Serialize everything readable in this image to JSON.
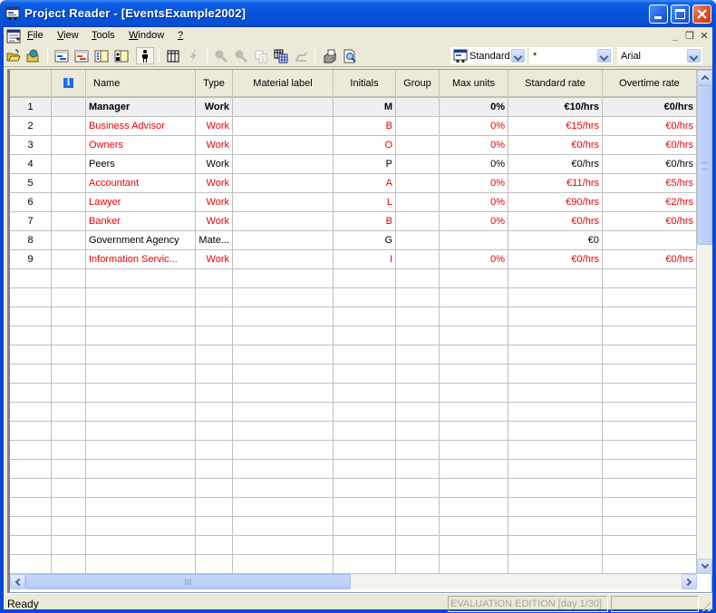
{
  "window": {
    "title": "Project Reader - [EventsExample2002]",
    "controls": {
      "minimize": "minimize",
      "maximize": "maximize",
      "close": "close"
    }
  },
  "menubar": {
    "items": [
      {
        "label": "File",
        "accel": "F"
      },
      {
        "label": "View",
        "accel": "V"
      },
      {
        "label": "Tools",
        "accel": "T"
      },
      {
        "label": "Window",
        "accel": "W"
      },
      {
        "label": "?",
        "accel": "?"
      }
    ],
    "mdi_controls": [
      "minimize",
      "restore",
      "close"
    ]
  },
  "toolbar": {
    "buttons": [
      {
        "icon": "open-folder-icon",
        "enabled": true
      },
      {
        "icon": "open-web-icon",
        "enabled": true
      },
      {
        "icon": "gantt-chart-icon",
        "enabled": true
      },
      {
        "icon": "tracking-gantt-icon",
        "enabled": true
      },
      {
        "icon": "task-usage-icon",
        "enabled": true
      },
      {
        "icon": "resource-usage-icon",
        "enabled": true
      },
      {
        "icon": "resource-sheet-icon",
        "enabled": true,
        "pressed": true
      },
      {
        "icon": "table-icon",
        "enabled": true
      },
      {
        "icon": "lightning-icon",
        "enabled": false
      },
      {
        "icon": "zoom-in-icon",
        "enabled": false
      },
      {
        "icon": "zoom-out-icon",
        "enabled": false
      },
      {
        "icon": "copy-icon",
        "enabled": false
      },
      {
        "icon": "copy-picture-icon",
        "enabled": true
      },
      {
        "icon": "go-to-icon",
        "enabled": false
      },
      {
        "icon": "print-icon",
        "enabled": true
      },
      {
        "icon": "print-preview-icon",
        "enabled": true
      }
    ],
    "table_combo": {
      "value": "Standard"
    },
    "filter_combo": {
      "value": "*"
    },
    "font_combo": {
      "value": "Arial"
    }
  },
  "grid": {
    "columns": [
      "",
      "i",
      "Name",
      "Type",
      "Material label",
      "Initials",
      "Group",
      "Max units",
      "Standard rate",
      "Overtime rate"
    ],
    "rows": [
      {
        "id": "1",
        "name": "Manager",
        "type": "Work",
        "material": "",
        "initials": "M",
        "group": "",
        "max_units": "0%",
        "std_rate": "€10/hrs",
        "ot_rate": "€0/hrs",
        "style": "bold",
        "selected": true
      },
      {
        "id": "2",
        "name": "Business Advisor",
        "type": "Work",
        "material": "",
        "initials": "B",
        "group": "",
        "max_units": "0%",
        "std_rate": "€15/hrs",
        "ot_rate": "€0/hrs",
        "style": "red"
      },
      {
        "id": "3",
        "name": "Owners",
        "type": "Work",
        "material": "",
        "initials": "O",
        "group": "",
        "max_units": "0%",
        "std_rate": "€0/hrs",
        "ot_rate": "€0/hrs",
        "style": "red"
      },
      {
        "id": "4",
        "name": "Peers",
        "type": "Work",
        "material": "",
        "initials": "P",
        "group": "",
        "max_units": "0%",
        "std_rate": "€0/hrs",
        "ot_rate": "€0/hrs",
        "style": "normal"
      },
      {
        "id": "5",
        "name": "Accountant",
        "type": "Work",
        "material": "",
        "initials": "A",
        "group": "",
        "max_units": "0%",
        "std_rate": "€11/hrs",
        "ot_rate": "€5/hrs",
        "style": "red"
      },
      {
        "id": "6",
        "name": "Lawyer",
        "type": "Work",
        "material": "",
        "initials": "L",
        "group": "",
        "max_units": "0%",
        "std_rate": "€90/hrs",
        "ot_rate": "€2/hrs",
        "style": "red"
      },
      {
        "id": "7",
        "name": "Banker",
        "type": "Work",
        "material": "",
        "initials": "B",
        "group": "",
        "max_units": "0%",
        "std_rate": "€0/hrs",
        "ot_rate": "€0/hrs",
        "style": "red"
      },
      {
        "id": "8",
        "name": "Government Agency",
        "type": "Mate...",
        "material": "",
        "initials": "G",
        "group": "",
        "max_units": "",
        "std_rate": "€0",
        "ot_rate": "",
        "style": "normal"
      },
      {
        "id": "9",
        "name": "Information Servic...",
        "type": "Work",
        "material": "",
        "initials": "I",
        "group": "",
        "max_units": "0%",
        "std_rate": "€0/hrs",
        "ot_rate": "€0/hrs",
        "style": "red"
      }
    ],
    "empty_rows": 16
  },
  "statusbar": {
    "text": "Ready",
    "edition": "EVALUATION EDITION  [day 1/30]"
  }
}
